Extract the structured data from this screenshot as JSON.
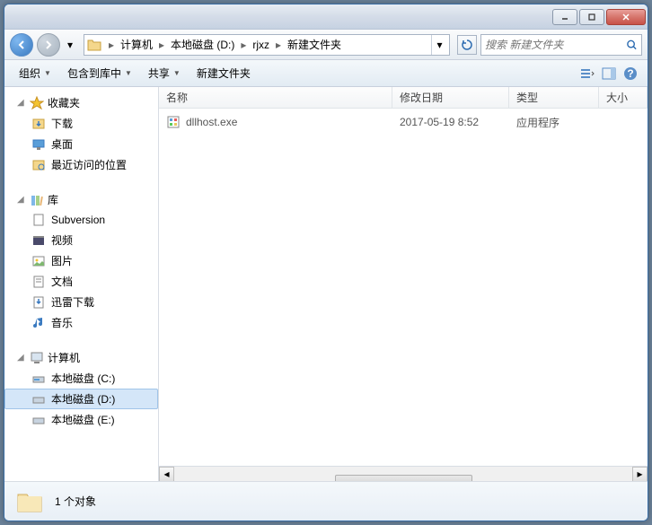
{
  "breadcrumbs": [
    "计算机",
    "本地磁盘 (D:)",
    "rjxz",
    "新建文件夹"
  ],
  "search": {
    "placeholder": "搜索 新建文件夹"
  },
  "toolbar": {
    "organize": "组织",
    "include": "包含到库中",
    "share": "共享",
    "newfolder": "新建文件夹"
  },
  "sidebar": {
    "favorites": {
      "label": "收藏夹",
      "items": [
        "下载",
        "桌面",
        "最近访问的位置"
      ]
    },
    "libraries": {
      "label": "库",
      "items": [
        "Subversion",
        "视频",
        "图片",
        "文档",
        "迅雷下载",
        "音乐"
      ]
    },
    "computer": {
      "label": "计算机",
      "items": [
        "本地磁盘 (C:)",
        "本地磁盘 (D:)",
        "本地磁盘 (E:)"
      ]
    }
  },
  "columns": {
    "name": "名称",
    "modified": "修改日期",
    "type": "类型",
    "size": "大小"
  },
  "files": [
    {
      "name": "dllhost.exe",
      "modified": "2017-05-19 8:52",
      "type": "应用程序"
    }
  ],
  "status": {
    "count": "1 个对象"
  }
}
